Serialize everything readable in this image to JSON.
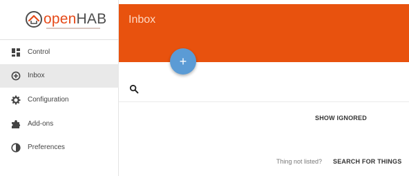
{
  "brand": {
    "name_part1": "open",
    "name_part2": "HAB",
    "accent_color": "#e64a19"
  },
  "sidebar": {
    "items": [
      {
        "label": "Control",
        "icon": "dashboard-icon"
      },
      {
        "label": "Inbox",
        "icon": "inbox-add-icon",
        "active": true
      },
      {
        "label": "Configuration",
        "icon": "gear-icon"
      },
      {
        "label": "Add-ons",
        "icon": "puzzle-icon"
      },
      {
        "label": "Preferences",
        "icon": "contrast-icon"
      }
    ]
  },
  "header": {
    "title": "Inbox",
    "color": "#e8520e"
  },
  "fab": {
    "label": "+",
    "color": "#5b9bd5"
  },
  "search": {
    "icon": "search-icon",
    "value": ""
  },
  "main": {
    "show_ignored_label": "SHOW IGNORED",
    "thing_not_listed_text": "Thing not listed?",
    "search_for_things_label": "SEARCH FOR THINGS"
  }
}
